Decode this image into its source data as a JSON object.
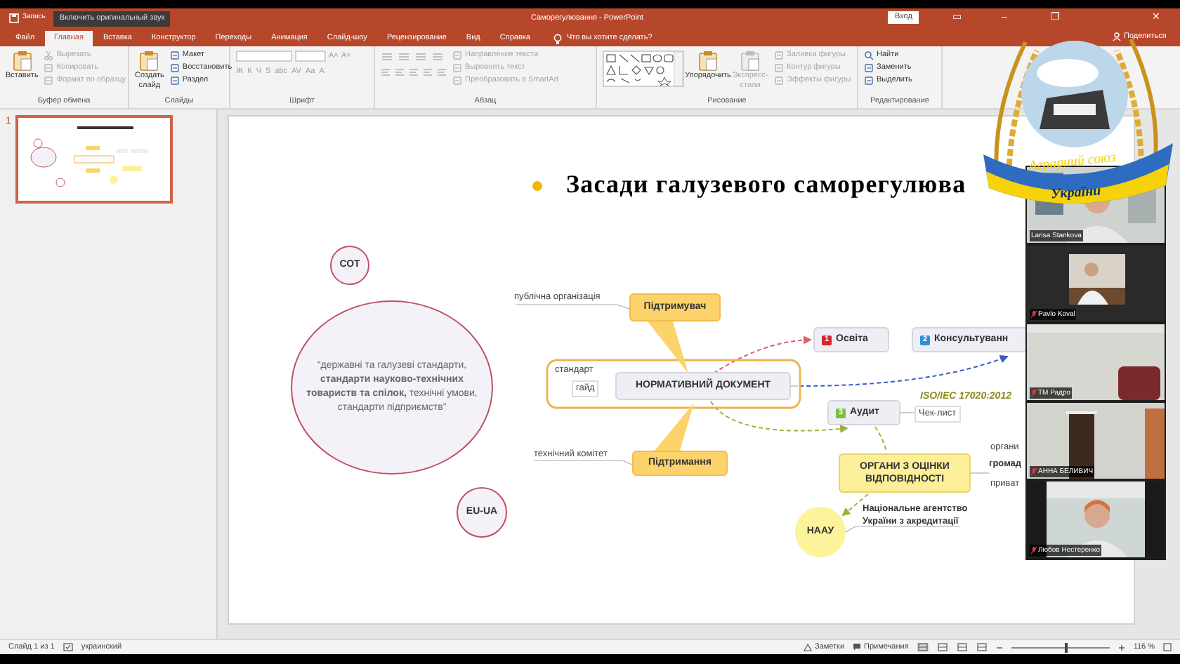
{
  "title_bar": {
    "recording": "Запись",
    "audio_button": "Включить оригинальный звук",
    "title": "Саморегулювання - PowerPoint",
    "sign_in": "Вход",
    "controls": [
      "▭",
      "–",
      "❐",
      "✕"
    ]
  },
  "tabs": [
    {
      "label": "Файл",
      "selected": false
    },
    {
      "label": "Главная",
      "selected": true
    },
    {
      "label": "Вставка",
      "selected": false
    },
    {
      "label": "Конструктор",
      "selected": false
    },
    {
      "label": "Переходы",
      "selected": false
    },
    {
      "label": "Анимация",
      "selected": false
    },
    {
      "label": "Слайд-шоу",
      "selected": false
    },
    {
      "label": "Рецензирование",
      "selected": false
    },
    {
      "label": "Вид",
      "selected": false
    },
    {
      "label": "Справка",
      "selected": false
    }
  ],
  "tell_me": "Что вы хотите сделать?",
  "share": "Поделиться",
  "ribbon_groups": [
    {
      "kind": "clipboard",
      "label": "Буфер обмена",
      "large": [
        {
          "label": "Вставить",
          "disabled": false
        }
      ],
      "small": [
        {
          "label": "Вырезать",
          "disabled": true
        },
        {
          "label": "Копировать",
          "disabled": true
        },
        {
          "label": "Формат по образцу",
          "disabled": true
        }
      ]
    },
    {
      "kind": "slides",
      "label": "Слайды",
      "large": [
        {
          "label": "Создать слайд",
          "disabled": false
        }
      ],
      "small": [
        {
          "label": "Макет",
          "disabled": false
        },
        {
          "label": "Восстановить",
          "disabled": false
        },
        {
          "label": "Раздел",
          "disabled": false
        }
      ]
    },
    {
      "kind": "font",
      "label": "Шрифт",
      "buttons": [
        "A˄",
        "A˅",
        "Ж",
        "К",
        "Ч",
        "S",
        "abc",
        "AV",
        "Aa",
        "A"
      ]
    },
    {
      "kind": "paragraph",
      "label": "Абзац",
      "small": [
        {
          "label": "Направление текста",
          "disabled": true
        },
        {
          "label": "Выровнять текст",
          "disabled": true
        },
        {
          "label": "Преобразовать в SmartArt",
          "disabled": true
        }
      ]
    },
    {
      "kind": "drawing",
      "label": "Рисование",
      "large": [
        {
          "label": "Упорядочить",
          "disabled": false
        },
        {
          "label": "Экспресс-стили",
          "disabled": true
        }
      ],
      "small": [
        {
          "label": "Заливка фигуры",
          "disabled": true
        },
        {
          "label": "Контур фигуры",
          "disabled": true
        },
        {
          "label": "Эффекты фигуры",
          "disabled": true
        }
      ]
    },
    {
      "kind": "editing",
      "label": "Редактирование",
      "small": [
        {
          "label": "Найти",
          "disabled": false
        },
        {
          "label": "Заменить",
          "disabled": false
        },
        {
          "label": "Выделить",
          "disabled": false
        }
      ]
    }
  ],
  "thumbnails": [
    {
      "number": "1",
      "selected": true
    }
  ],
  "slide": {
    "title": "Засади галузевого саморегулюва",
    "nodes": [
      {
        "kind": "circle",
        "text": "СОТ"
      },
      {
        "kind": "ellipse",
        "text": "“державні та галузеві стандарти, **стандарти науково-технічних товариств та спілок,** технічні умови, стандарти підприємств”"
      },
      {
        "kind": "label",
        "text": "публічна організація"
      },
      {
        "kind": "callout",
        "text": "Підтримувач"
      },
      {
        "kind": "numbered",
        "number": "1",
        "color": "#d7262e",
        "text": "Освіта"
      },
      {
        "kind": "numbered",
        "number": "2",
        "color": "#2f8fd6",
        "text": "Консультуванн"
      },
      {
        "kind": "label",
        "text": "стандарт"
      },
      {
        "kind": "boxed_label",
        "text": "гайд"
      },
      {
        "kind": "topic",
        "text": "НОРМАТИВНИЙ ДОКУМЕНТ"
      },
      {
        "kind": "note",
        "text": "ISO/IEC 17020:2012"
      },
      {
        "kind": "numbered",
        "number": "3",
        "color": "#7abf3f",
        "text": "Аудит"
      },
      {
        "kind": "boxed_label",
        "text": "Чек-лист"
      },
      {
        "kind": "label",
        "text": "органи"
      },
      {
        "kind": "bold_label",
        "text": "громад"
      },
      {
        "kind": "label",
        "text": "технічний комітет"
      },
      {
        "kind": "callout",
        "text": "Підтримання"
      },
      {
        "kind": "organ",
        "text": "ОРГАНИ З ОЦІНКИ ВІДПОВІДНОСТІ"
      },
      {
        "kind": "label",
        "text": "приват"
      },
      {
        "kind": "circle",
        "text": "EU-UA"
      },
      {
        "kind": "yellow_circle",
        "text": "НААУ"
      },
      {
        "kind": "bold_label",
        "text": "Національне агентство України з акредитації"
      }
    ]
  },
  "logo": {
    "line_1": "Аграрний союз",
    "line_2": "України"
  },
  "participants": [
    {
      "name": "Larisa Stankova",
      "muted": false
    },
    {
      "name": "Pavlo Koval",
      "muted": true
    },
    {
      "name": "TM Радро",
      "muted": true
    },
    {
      "name": "АННА БЕЛИВИЧ",
      "muted": true
    },
    {
      "name": "Любов Нестеренко",
      "muted": true
    }
  ],
  "status_bar": {
    "slide": "Слайд 1 из 1",
    "language": "украинский",
    "notes": "Заметки",
    "comments": "Примечания",
    "zoom": {
      "level": 0.55,
      "reading": "116 %"
    }
  }
}
